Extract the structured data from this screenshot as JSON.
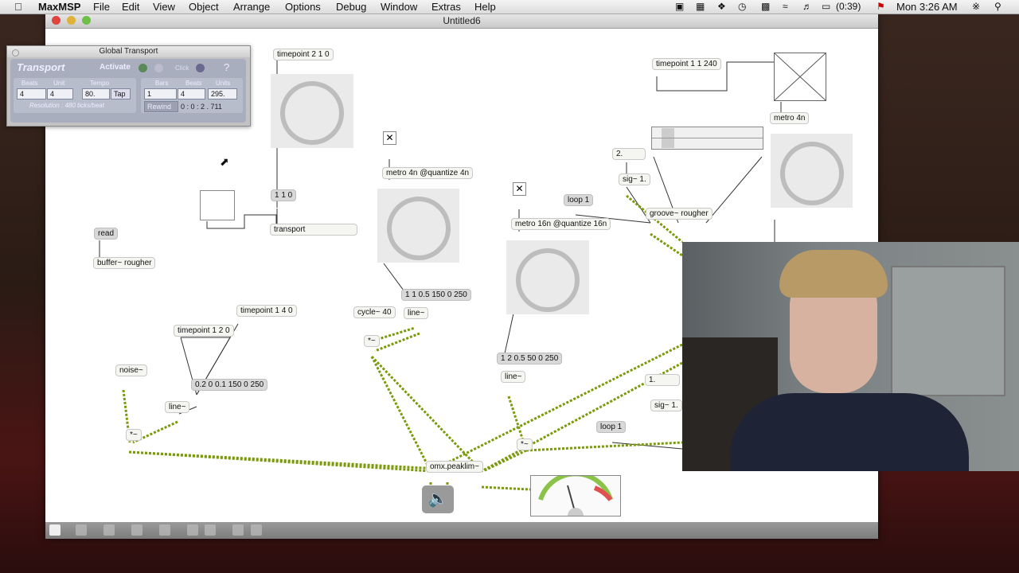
{
  "menubar": {
    "apple": "",
    "app": "MaxMSP",
    "items": [
      "File",
      "Edit",
      "View",
      "Object",
      "Arrange",
      "Options",
      "Debug",
      "Window",
      "Extras",
      "Help"
    ],
    "battery": "(0:39)",
    "clock": "Mon 3:26 AM"
  },
  "window": {
    "title": "Untitled6"
  },
  "transport_window": {
    "title": "Global Transport",
    "heading": "Transport",
    "activate_label": "Activate",
    "click_label": "Click",
    "help_label": "?",
    "col_beats": "Beats",
    "col_unit": "Unit",
    "col_tempo": "Tempo",
    "col_bars": "Bars",
    "col_beats2": "Beats",
    "col_units": "Units",
    "beats_value": "4",
    "unit_value": "4",
    "tempo_value": "80.",
    "tap_label": "Tap",
    "bars_value": "1",
    "beats2_value": "4",
    "units_value": "295.",
    "rewind_label": "Rewind",
    "time_readout": "0 : 0 : 2 . 711",
    "resolution": "Resolution : 480 ticks/beat"
  },
  "objects": {
    "tp210": "timepoint 2 1 0",
    "tp11240": "timepoint 1 1 240",
    "metro4n_right": "metro 4n",
    "metro4nq": "metro 4n @quantize 4n",
    "metro16nq": "metro 16n @quantize 16n",
    "msg110": "1 1 0",
    "transport": "transport",
    "read": "read",
    "buffer": "buffer~ rougher",
    "loop1a": "loop 1",
    "loop1b": "loop 1",
    "groove": "groove~ rougher",
    "sig1a": "sig~ 1.",
    "sig1b": "sig~ 1.",
    "num2": "2.",
    "num1": "1.",
    "msg1105": "1 1 0.5 150 0 250",
    "cycle": "cycle~ 40",
    "line_a": "line~",
    "times_a": "*~",
    "tp140": "timepoint 1 4 0",
    "tp120": "timepoint 1 2 0",
    "noise": "noise~",
    "msg2001": "0.2 0 0.1 150 0 250",
    "line_b": "line~",
    "times_b": "*~",
    "msg1205": "1 2 0.5 50 0 250",
    "line_c": "line~",
    "times_c": "*~",
    "omx": "omx.peaklim~"
  },
  "colors": {
    "patchcord_signal": "#7a9a0a",
    "patchcord": "#333333",
    "knob_ring": "#bdbdbd"
  }
}
